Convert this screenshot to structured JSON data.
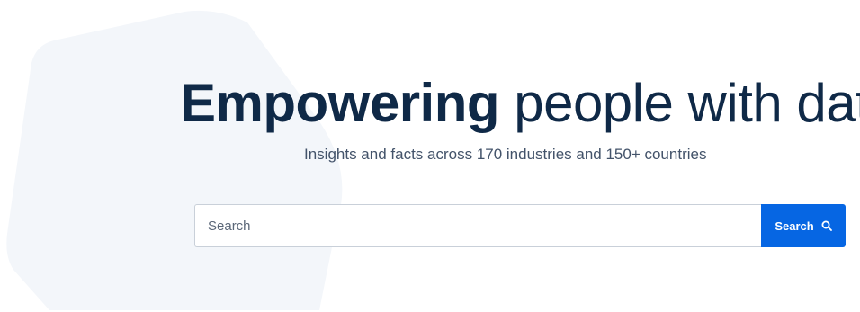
{
  "hero": {
    "headline_strong": "Empowering",
    "headline_light": "people with data",
    "subtitle": "Insights and facts across 170 industries and 150+ countries"
  },
  "search": {
    "placeholder": "Search",
    "button_label": "Search",
    "button_icon": "search-icon"
  },
  "colors": {
    "headline": "#0f2947",
    "subtitle": "#43536a",
    "accent": "#0666e3",
    "background_shape": "#f3f6fa"
  }
}
